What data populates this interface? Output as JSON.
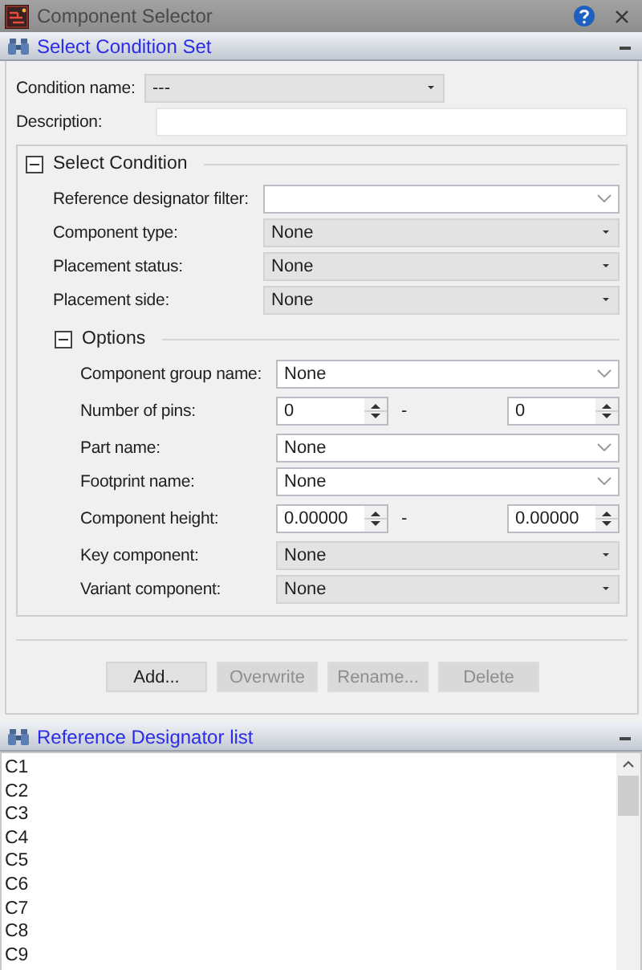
{
  "window": {
    "title": "Component Selector"
  },
  "condition_set": {
    "title": "Select Condition Set",
    "expanded": true,
    "condition_name": {
      "label": "Condition name:",
      "kind": "select",
      "value": "---"
    },
    "description": {
      "label": "Description:",
      "kind": "text"
    },
    "select_condition": {
      "title": "Select Condition",
      "expanded": true,
      "fields": [
        {
          "kind": "combo",
          "label": "Reference designator filter:"
        },
        {
          "kind": "select",
          "label": "Component type:",
          "value": "None"
        },
        {
          "kind": "select",
          "label": "Placement status:",
          "value": "None"
        },
        {
          "kind": "select",
          "label": "Placement side:",
          "value": "None"
        }
      ],
      "options": {
        "title": "Options",
        "expanded": true,
        "fields": [
          {
            "kind": "combo",
            "label": "Component group name:",
            "value": "None"
          },
          {
            "kind": "range",
            "label": "Number of pins:",
            "from": "0",
            "separator": "-",
            "to": "0"
          },
          {
            "kind": "combo",
            "label": "Part name:",
            "value": "None"
          },
          {
            "kind": "combo",
            "label": "Footprint name:",
            "value": "None"
          },
          {
            "kind": "range",
            "label": "Component height:",
            "from": "0.00000",
            "separator": "-",
            "to": "0.00000"
          },
          {
            "kind": "select",
            "label": "Key component:",
            "value": "None"
          },
          {
            "kind": "select",
            "label": "Variant component:",
            "value": "None"
          }
        ]
      }
    },
    "buttons": [
      {
        "label": "Add...",
        "disabled": false
      },
      {
        "label": "Overwrite",
        "disabled": true
      },
      {
        "label": "Rename...",
        "disabled": true
      },
      {
        "label": "Delete",
        "disabled": true
      }
    ]
  },
  "reference_designator_list": {
    "title": "Reference Designator list",
    "expanded": true,
    "items": [
      "C1",
      "C2",
      "C3",
      "C4",
      "C5",
      "C6",
      "C7",
      "C8",
      "C9"
    ]
  }
}
